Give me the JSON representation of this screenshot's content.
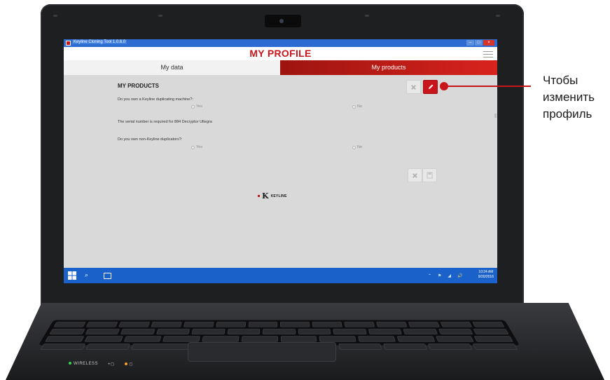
{
  "window": {
    "title": "Keyline Cloning Tool 1.0.6.0",
    "controls": [
      "–",
      "□",
      "×"
    ]
  },
  "header": {
    "title": "MY PROFILE"
  },
  "tabs": [
    {
      "label": "My data",
      "active": false
    },
    {
      "label": "My products",
      "active": true
    }
  ],
  "products": {
    "section_title": "MY PRODUCTS",
    "q1": {
      "text": "Do you own a Keyline duplicating machine?:",
      "yes": "Yes",
      "no": "No"
    },
    "serial_note": "The serial number is required for 884 Decryptor Ultegra",
    "q2": {
      "text": "Do you own non-Keyline duplicators?:",
      "yes": "Yes",
      "no": "No"
    }
  },
  "logo": {
    "mark": "K",
    "text": "KEYLINE"
  },
  "taskbar": {
    "search_glyph": "⌕",
    "tray": [
      "⌃",
      "⚑",
      "◢",
      "🔊"
    ],
    "time": "10:24 AM",
    "date": "9/30/2016"
  },
  "laptop": {
    "status_left": "WIRELESS",
    "status_mid": "+◻",
    "status_right": "◻"
  },
  "callout": {
    "line1": "Чтобы",
    "line2": "изменить",
    "line3": "профиль"
  },
  "colors": {
    "brand_red": "#c8151b",
    "taskbar_blue": "#1a62c9"
  }
}
